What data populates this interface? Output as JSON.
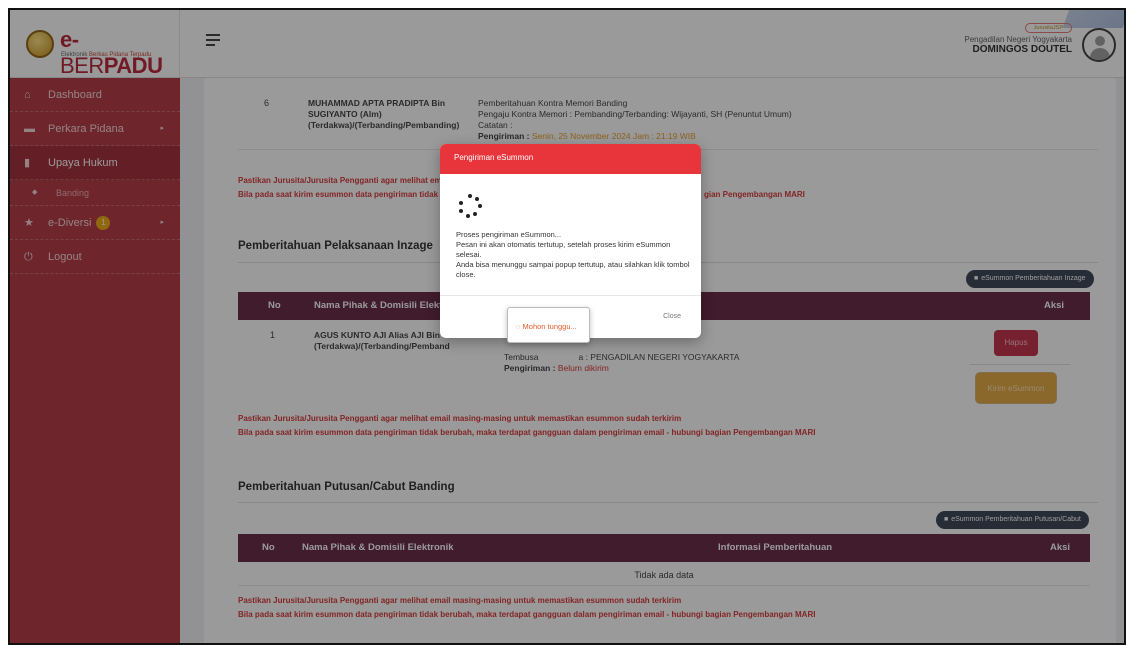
{
  "header": {
    "logo_main_1": "e-",
    "logo_main_2": "BER",
    "logo_main_3": "PADU",
    "logo_sub_1": "Elektronik ",
    "logo_sub_2": "Berkas Pidana Terpadu",
    "user_badge": "JurusitaJSP",
    "court_name": "Pengadilan Negeri Yogyakarta",
    "user_name": "DOMINGOS DOUTEL"
  },
  "sidebar": {
    "items": [
      {
        "label": "Dashboard",
        "icon": "home-icon"
      },
      {
        "label": "Perkara Pidana",
        "icon": "folder-icon",
        "arrow": "▸"
      },
      {
        "label": "Upaya Hukum",
        "icon": "document-icon"
      },
      {
        "label": "Banding",
        "icon": "dot-icon"
      },
      {
        "label": "e-Diversi",
        "icon": "star-icon",
        "badge": "1",
        "arrow": "▸"
      },
      {
        "label": "Logout",
        "icon": "power-icon"
      }
    ]
  },
  "top_row": {
    "no": "6",
    "name": "MUHAMMAD APTA PRADIPTA Bin SUGIYANTO (Alm) (Terdakwa)/(Terbanding/Pembanding)",
    "info_1": "Pemberitahuan Kontra Memori Banding",
    "info_2": "Pengaju Kontra Memori : Pembanding/Terbanding: Wijayanti, SH (Penuntut Umum)",
    "info_3": "Catatan :",
    "info_4_label": "Pengiriman :",
    "info_4_value": "Senin, 25 November 2024 Jam : 21:19 WIB"
  },
  "warnings": {
    "line1": "Pastikan Jurusita/Jurusita Pengganti agar melihat email masing-masing untuk memastikan esummon sudah terkirim",
    "line2": "Bila pada saat kirim esummon data pengiriman tidak berubah, maka terdapat gangguan dalam pengiriman email - hubungi bagian Pengembangan MARI",
    "line1_short": "Pastikan Jurusita/Jurusita Pengganti agar melihat email",
    "line2_short": "Bila pada saat kirim esummon data pengiriman tidak be",
    "line2_tail": "gian Pengembangan MARI"
  },
  "inzage": {
    "title": "Pemberitahuan Pelaksanaan Inzage",
    "button": "eSummon Pemberitahuan Inzage",
    "columns": {
      "no": "No",
      "name": "Nama Pihak & Domisili Elektr",
      "aksi": "Aksi"
    },
    "row": {
      "no": "1",
      "name": "AGUS KUNTO AJI Alias AJI Bin SA (Terdakwa)/(Terbanding/Pemband",
      "tembusan": "Tembusa",
      "tembusan_tail": "a : PENGADILAN NEGERI YOGYAKARTA",
      "pengiriman_label": "Pengiriman :",
      "pengiriman_value": "Belum dikirim",
      "hapus": "Hapus",
      "kirim": "Kirim eSummon"
    }
  },
  "putusan": {
    "title": "Pemberitahuan Putusan/Cabut Banding",
    "button": "eSummon Pemberitahuan Putusan/Cabut",
    "columns": {
      "no": "No",
      "name": "Nama Pihak & Domisili Elektronik",
      "info": "Informasi Pemberitahuan",
      "aksi": "Aksi"
    },
    "empty": "Tidak ada data"
  },
  "modal": {
    "title": "Pengiriman eSummon",
    "line1": "Proses pengiriman eSummon...",
    "line2": "Pesan ini akan otomatis tertutup, setelah proses kirim eSummon selesai.",
    "line3": "Anda bisa menunggu sampai popup tertutup, atau silahkan klik tombol close.",
    "close": "Close",
    "wait": "Mohon tunggu..."
  },
  "colors": {
    "sidebar": "#b02a36",
    "table_head": "#5c1a3a",
    "modal_head": "#e8353b",
    "warning": "#d42a2a"
  }
}
